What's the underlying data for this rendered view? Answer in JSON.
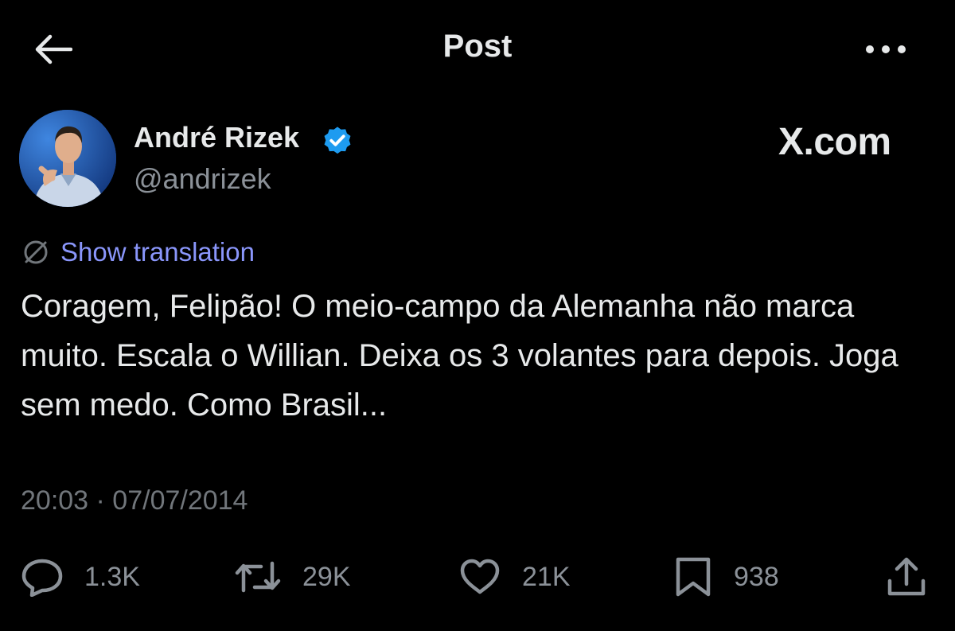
{
  "header": {
    "title": "Post",
    "back_icon": "arrow-left-icon",
    "more_icon": "ellipsis-icon"
  },
  "author": {
    "name": "André Rizek",
    "handle": "@andrizek",
    "verified": true,
    "verified_color": "#1d9bf0"
  },
  "brand": {
    "watermark": "X.com"
  },
  "translation": {
    "label": "Show translation",
    "color": "#8a96fb"
  },
  "post": {
    "text": "Coragem, Felipão! O meio-campo da Alemanha não marca muito. Escala o Willian. Deixa os 3 volantes para depois. Joga sem medo. Como Brasil...",
    "timestamp": "20:03 · 07/07/2014"
  },
  "actions": {
    "reply": {
      "icon": "reply-icon",
      "count": "1.3K"
    },
    "repost": {
      "icon": "repost-icon",
      "count": "29K"
    },
    "like": {
      "icon": "heart-icon",
      "count": "21K"
    },
    "bookmark": {
      "icon": "bookmark-icon",
      "count": "938"
    },
    "share": {
      "icon": "share-icon"
    }
  },
  "colors": {
    "background": "#000000",
    "text_primary": "#e7e9ea",
    "text_secondary": "#71767b"
  }
}
